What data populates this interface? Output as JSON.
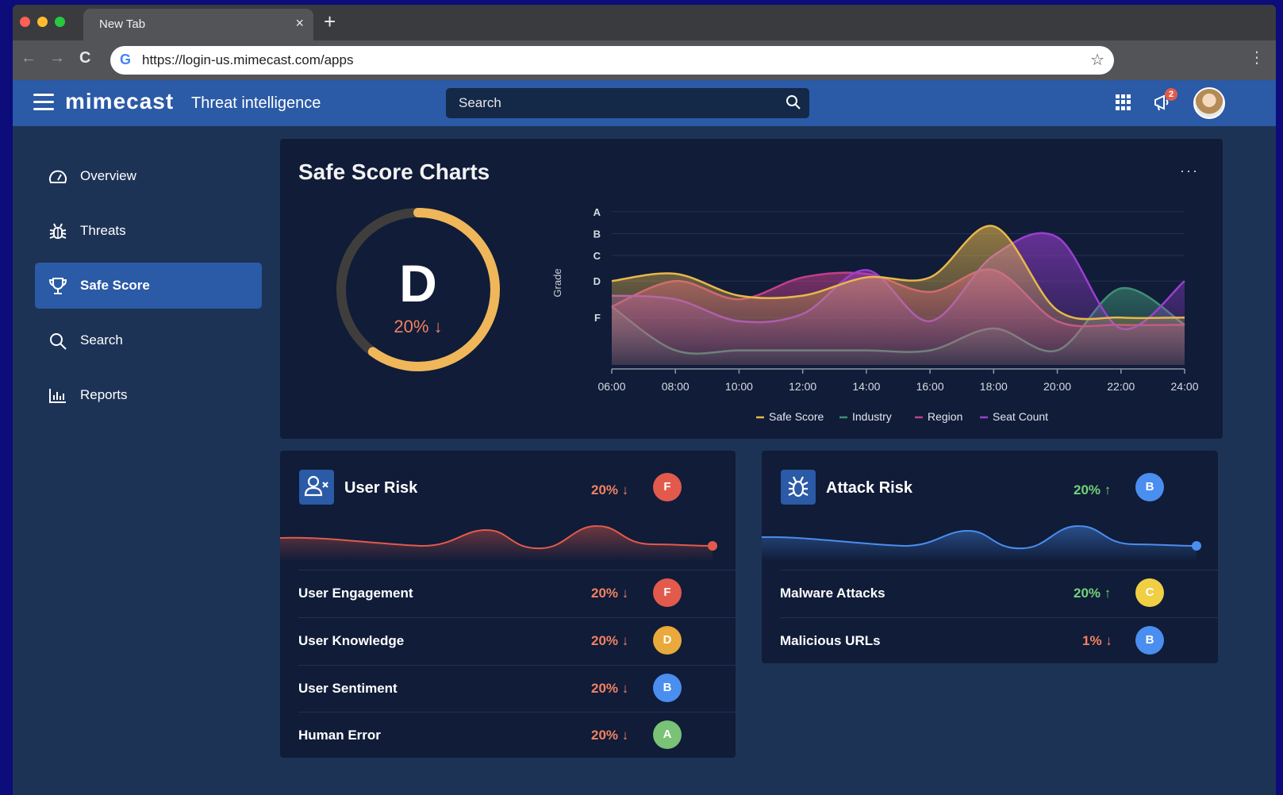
{
  "browser": {
    "tab_title": "New Tab",
    "tab_close": "×",
    "new_tab": "+",
    "url": "https://login-us.mimecast.com/apps",
    "back": "←",
    "forward": "→",
    "reload": "C",
    "g_icon": "G",
    "star": "☆",
    "menu": "⋮"
  },
  "header": {
    "logo": "mimecast",
    "subtitle": "Threat intelligence",
    "search_placeholder": "Search",
    "notification_count": "2"
  },
  "sidebar": {
    "items": [
      {
        "label": "Overview",
        "icon": "speedometer-icon"
      },
      {
        "label": "Threats",
        "icon": "bug-icon"
      },
      {
        "label": "Safe Score",
        "icon": "trophy-icon",
        "active": true
      },
      {
        "label": "Search",
        "icon": "search-icon"
      },
      {
        "label": "Reports",
        "icon": "bar-chart-icon"
      }
    ]
  },
  "safe_score": {
    "title": "Safe Score Charts",
    "more": "···",
    "grade": "D",
    "change": "20% ↓",
    "gauge_fill": 0.6
  },
  "chart_data": {
    "type": "area",
    "ylabel": "Grade",
    "y_ticks": [
      "A",
      "B",
      "C",
      "D",
      "F"
    ],
    "x": [
      "06:00",
      "08:00",
      "10:00",
      "12:00",
      "14:00",
      "16:00",
      "18:00",
      "20:00",
      "22:00",
      "24:00"
    ],
    "series": [
      {
        "name": "Safe Score",
        "color": "#e9b74a",
        "values": [
          2.3,
          2.5,
          1.9,
          1.9,
          2.4,
          2.4,
          3.8,
          1.5,
          1.3,
          1.3
        ]
      },
      {
        "name": "Industry",
        "color": "#3f8f74",
        "values": [
          1.6,
          0.4,
          0.4,
          0.4,
          0.4,
          0.4,
          1.0,
          0.4,
          2.1,
          1.1
        ]
      },
      {
        "name": "Region",
        "color": "#c13f86",
        "values": [
          1.6,
          2.3,
          1.8,
          2.4,
          2.5,
          2.0,
          2.6,
          1.2,
          1.1,
          1.1
        ]
      },
      {
        "name": "Seat Count",
        "color": "#9b3fd0",
        "values": [
          1.9,
          1.8,
          1.2,
          1.4,
          2.6,
          1.2,
          3.0,
          3.5,
          1.0,
          2.3
        ]
      }
    ]
  },
  "user_risk": {
    "title": "User Risk",
    "change": "20% ↓",
    "grade": "F",
    "rows": [
      {
        "label": "User Engagement",
        "change": "20% ↓",
        "grade": "F"
      },
      {
        "label": "User Knowledge",
        "change": "20% ↓",
        "grade": "D"
      },
      {
        "label": "User Sentiment",
        "change": "20% ↓",
        "grade": "B"
      },
      {
        "label": "Human Error",
        "change": "20% ↓",
        "grade": "A"
      }
    ]
  },
  "attack_risk": {
    "title": "Attack Risk",
    "change": "20% ↑",
    "grade": "B",
    "rows": [
      {
        "label": "Malware Attacks",
        "change": "20% ↑",
        "grade": "C"
      },
      {
        "label": "Malicious URLs",
        "change": "1% ↓",
        "grade": "B"
      }
    ]
  },
  "colors": {
    "accent": "#2b5aa6",
    "grade_F": "#e25a4b",
    "grade_D": "#e9a93b",
    "grade_C": "#f1cf45",
    "grade_B": "#4a8ef0",
    "grade_A": "#79c276",
    "down": "#f28161",
    "up": "#73d27a"
  }
}
